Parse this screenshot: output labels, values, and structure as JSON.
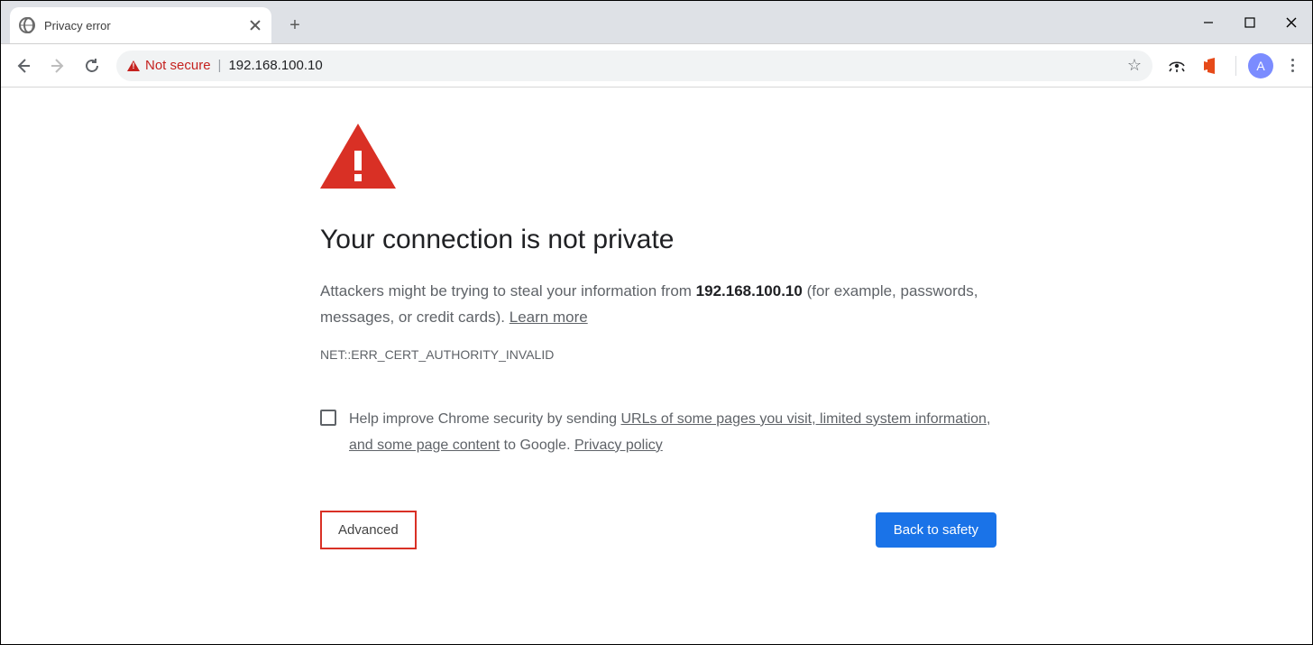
{
  "tab": {
    "title": "Privacy error"
  },
  "omnibox": {
    "not_secure_label": "Not secure",
    "url": "192.168.100.10"
  },
  "avatar_initial": "A",
  "interstitial": {
    "heading": "Your connection is not private",
    "body_pre": "Attackers might be trying to steal your information from ",
    "host": "192.168.100.10",
    "body_post": " (for example, passwords, messages, or credit cards). ",
    "learn_more": "Learn more",
    "error_code": "NET::ERR_CERT_AUTHORITY_INVALID",
    "optin_pre": "Help improve Chrome security by sending ",
    "optin_link1": "URLs of some pages you visit, limited system information, and some page content",
    "optin_mid": " to Google. ",
    "optin_link2": "Privacy policy",
    "advanced_btn": "Advanced",
    "back_btn": "Back to safety"
  }
}
